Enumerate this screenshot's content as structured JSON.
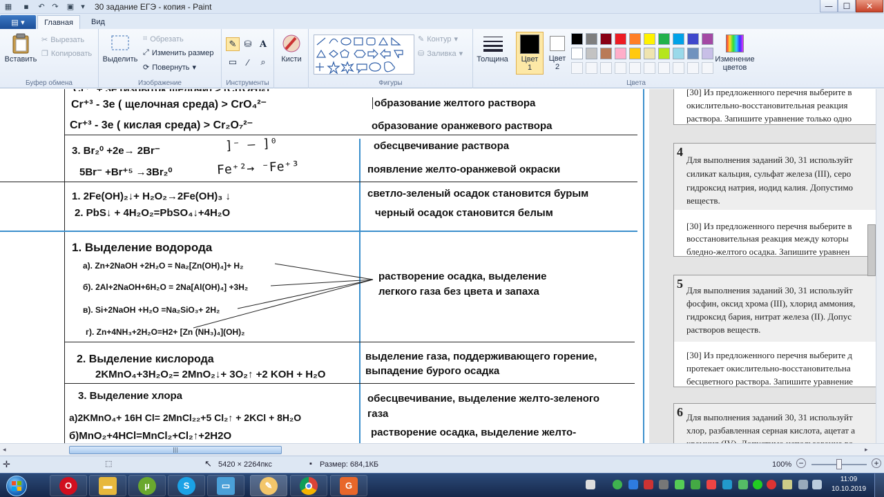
{
  "window": {
    "title": "30 задание ЕГЭ - копия - Paint",
    "minimize": "—",
    "maximize": "☐",
    "close": "✕"
  },
  "tabs": {
    "file": "▤ ▾",
    "home": "Главная",
    "view": "Вид"
  },
  "ribbon": {
    "clipboard": {
      "label": "Буфер обмена",
      "paste": "Вставить",
      "cut": "Вырезать",
      "copy": "Копировать"
    },
    "image": {
      "label": "Изображение",
      "select": "Выделить",
      "crop": "Обрезать",
      "resize": "Изменить размер",
      "rotate": "Повернуть"
    },
    "tools": {
      "label": "Инструменты"
    },
    "brushes": {
      "label": "Кисти"
    },
    "shapes": {
      "label": "Фигуры",
      "outline": "Контур",
      "fill": "Заливка"
    },
    "thickness": {
      "label": "Толщина"
    },
    "colors": {
      "label": "Цвета",
      "color1": "Цвет 1",
      "color2": "Цвет 2",
      "edit": "Изменение цветов",
      "palette_row1": [
        "#000000",
        "#7f7f7f",
        "#880015",
        "#ed1c24",
        "#ff7f27",
        "#fff200",
        "#22b14c",
        "#00a2e8",
        "#3f48cc",
        "#a349a4"
      ],
      "palette_row2": [
        "#ffffff",
        "#c3c3c3",
        "#b97a57",
        "#ffaec9",
        "#ffc90e",
        "#efe4b0",
        "#b5e61d",
        "#99d9ea",
        "#7092be",
        "#c8bfe7"
      ]
    }
  },
  "doc": {
    "rows": [
      {
        "left": "Cr⁺³ - 3e (  щелочная среда) >  CrO₄²⁻",
        "right": "образование желтого раствора"
      },
      {
        "left": "Cr⁺³ - 3e (  кислая  среда) >  Cr₂O₇²⁻",
        "right": "образование оранжевого раствора"
      },
      {
        "left": "3. Br₂⁰ +2e→ 2Br⁻",
        "right": "обесцвечивание раствора"
      },
      {
        "left": "5Br⁻ +Br⁺⁵ →3Br₂⁰",
        "right": "появление желто-оранжевой окраски"
      },
      {
        "left": "1. 2Fe(OH)₂↓+ H₂O₂→2Fe(OH)₃ ↓",
        "right": "светло-зеленый осадок становится бурым"
      },
      {
        "left": "2. PbS↓ + 4H₂O₂=PbSO₄↓+4H₂O",
        "right": "черный осадок становится белым"
      }
    ],
    "hydrogen": {
      "title": "1. Выделение водорода",
      "a": "а).  Zn+2NaOH +2H₂O = Na₂[Zn(OH)₄]+ H₂",
      "b": "б).  2Al+2NaOH+6H₂O = 2Na[Al(OH)₄] +3H₂",
      "c": "в).  Si+2NaOH +H₂O =Na₂SiO₃+ 2H₂",
      "d": "г).    Zn+4NH₃+2H₂O=H2+ [Zn (NH₃)₄](OH)₂",
      "right1": "растворение осадка, выделение",
      "right2": "легкого газа без цвета и запаха"
    },
    "oxygen": {
      "title": "2. Выделение кислорода",
      "eq": "2KMnO₄+3H₂O₂= 2MnO₂↓+ 3O₂↑ +2 KOH + H₂O",
      "right1": "выделение газа, поддерживающего горение,",
      "right2": "выпадение бурого осадка"
    },
    "chlorine": {
      "title": "3. Выделение хлора",
      "a": "а)2KMnO₄+ 16H Cl=  2MnCl₂₂+5 Cl₂↑ +  2KCl + 8H₂O",
      "b": "б)MnO₂+4HCl=MnCl₂+Cl₂↑+2H2O",
      "right1": "обесцвечивание, выделение желто-зеленого",
      "right2": "газа",
      "right3": "растворение осадка, выделение желто-"
    },
    "hand_top": "]⁻ —  ]⁰",
    "hand_bottom": "Fe⁺²→  ⁻Fe⁺³"
  },
  "panel": {
    "card1": {
      "l1": "[30] Из предложенного перечня выберите в",
      "l2": "окислительно-восстановительная реакция",
      "l3": "раствора. Запишите уравнение только одно"
    },
    "card4": {
      "num": "4",
      "l1": "Для выполнения заданий 30, 31 используйт",
      "l2": "силикат кальция, сульфат железа (III), серо",
      "l3": "гидроксид натрия, иодид калия. Допустимо",
      "l4": "веществ.",
      "l5": "[30] Из предложенного перечня выберите в",
      "l6": "восстановительная реакция между которы",
      "l7": "бледно-желтого осадка. Запишите уравнен"
    },
    "card5": {
      "num": "5",
      "l1": "Для выполнения заданий 30, 31 используйт",
      "l2": "фосфин, оксид хрома (III), хлорид аммония,",
      "l3": "гидроксид бария, нитрат железа (II). Допус",
      "l4": "растворов веществ.",
      "l5": "[30] Из предложенного перечня выберите д",
      "l6": "протекает окислительно-восстановительна",
      "l7": "бесцветного раствора. Запишите уравнение"
    },
    "card6": {
      "num": "6",
      "l1": "Для выполнения заданий 30, 31 используйт",
      "l2": "хлор, разбавленная серная кислота, ацетат а",
      "l3": "кремния (IV). Допустимо использование во"
    }
  },
  "status": {
    "dimensions": "5420 × 2264пкс",
    "size": "Размер: 684,1КБ",
    "zoom": "100%"
  },
  "taskbar": {
    "clock_time": "11:09",
    "clock_date": "10.10.2019"
  }
}
